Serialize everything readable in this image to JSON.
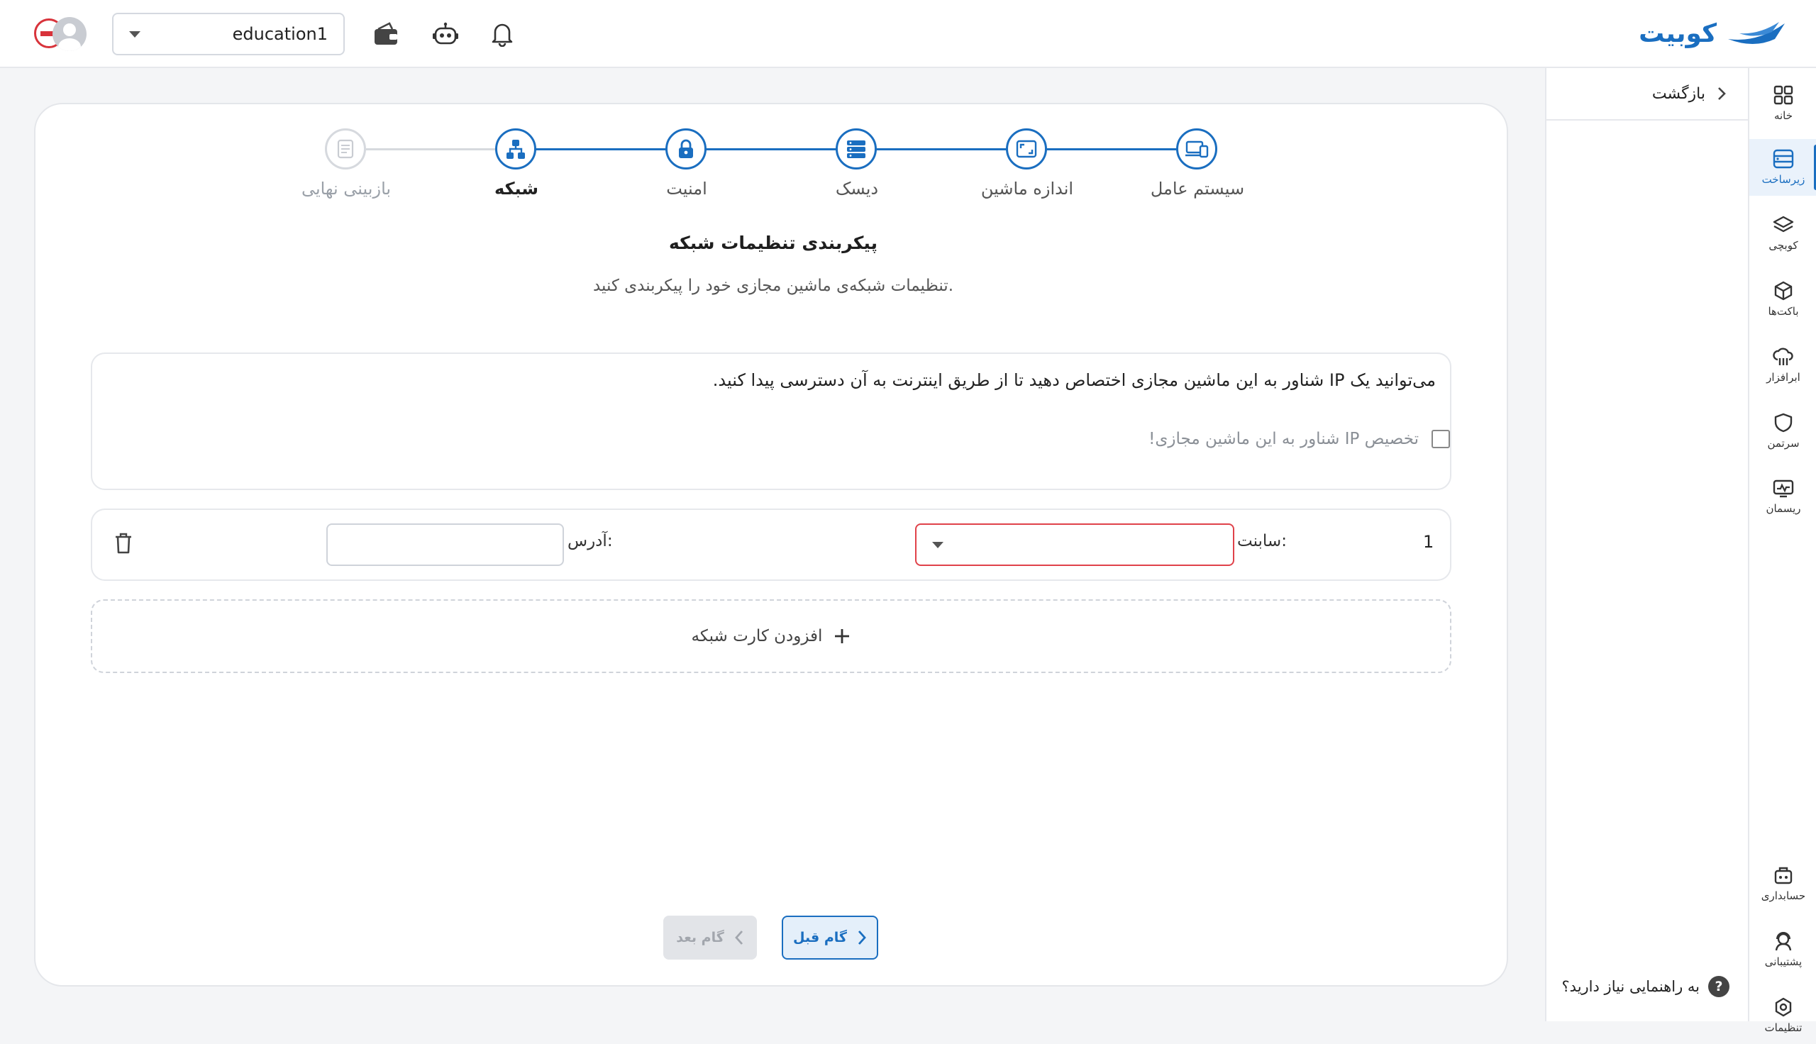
{
  "header": {
    "brand_name": "کوبیت",
    "project": "education1",
    "colors": {
      "accent": "#1a6ec0",
      "error": "#e0424a"
    }
  },
  "rail": {
    "items": [
      {
        "label": "خانه",
        "icon": "grid-icon"
      },
      {
        "label": "زیرساخت",
        "icon": "server-icon",
        "active": true
      },
      {
        "label": "کوبچی",
        "icon": "layers-icon"
      },
      {
        "label": "باکت‌ها",
        "icon": "box-icon"
      },
      {
        "label": "ابرافزار",
        "icon": "cloud-app-icon"
      },
      {
        "label": "سرتمن",
        "icon": "shield-icon"
      },
      {
        "label": "ریسمان",
        "icon": "monitor-icon"
      },
      {
        "label": "حسابداری",
        "icon": "accounting-icon"
      },
      {
        "label": "پشتیبانی",
        "icon": "support-icon"
      },
      {
        "label": "تنظیمات",
        "icon": "settings-icon"
      }
    ]
  },
  "subpanel": {
    "back_label": "بازگشت",
    "help_label": "به راهنمایی نیاز دارید؟",
    "help_glyph": "?"
  },
  "steps": [
    {
      "label": "سیستم عامل",
      "icon": "devices-icon",
      "state": "done"
    },
    {
      "label": "اندازه ماشین",
      "icon": "resize-icon",
      "state": "done"
    },
    {
      "label": "دیسک",
      "icon": "disk-icon",
      "state": "done"
    },
    {
      "label": "امنیت",
      "icon": "lock-icon",
      "state": "done"
    },
    {
      "label": "شبکه",
      "icon": "network-icon",
      "state": "current"
    },
    {
      "label": "بازبینی نهایی",
      "icon": "review-icon",
      "state": "pending"
    }
  ],
  "form": {
    "title": "پیکربندی تنظیمات شبکه",
    "subtitle": "تنظیمات شبکه‌ی ماشین مجازی خود را پیکربندی کنید.",
    "floating_ip": {
      "description": "می‌توانید یک IP شناور به این ماشین مجازی اختصاص دهید تا از طریق اینترنت به آن دسترسی پیدا کنید.",
      "checkbox_label": "تخصیص IP شناور به این ماشین مجازی!"
    },
    "nic_row": {
      "index": "1",
      "subnet_label": "سابنت:",
      "subnet_value": "",
      "address_label": "آدرس:",
      "address_value": ""
    },
    "add_nic_label": "افزودن کارت شبکه"
  },
  "buttons": {
    "prev_label": "گام قبل",
    "next_label": "گام بعد"
  }
}
